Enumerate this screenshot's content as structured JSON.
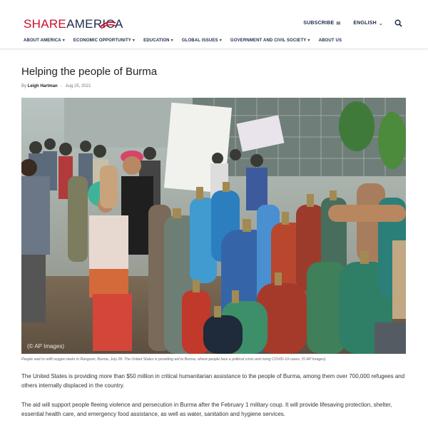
{
  "header": {
    "logo_share": "SHARE",
    "logo_america": "AMERICA",
    "subscribe": "SUBSCRIBE",
    "language": "ENGLISH",
    "search_icon": "search-icon"
  },
  "nav": {
    "items": [
      {
        "label": "ABOUT AMERICA"
      },
      {
        "label": "ECONOMIC OPPORTUNITY"
      },
      {
        "label": "EDUCATION"
      },
      {
        "label": "GLOBAL ISSUES"
      },
      {
        "label": "GOVERNMENT AND CIVIL SOCIETY"
      },
      {
        "label": "ABOUT US"
      }
    ]
  },
  "article": {
    "title": "Helping the people of Burma",
    "by": "By",
    "author": "Leigh Hartman",
    "date": "Aug 25, 2021",
    "photo_watermark": "(© AP Images)",
    "caption": "People wait to refill oxygen tanks in Rangoon, Burma, July 28. The United States is providing aid to Burma, where people face a political crisis and rising COVID-19 cases. (© AP Images)",
    "paragraph_1": "The United States is providing more than $50 million in critical humanitarian assistance to the people of Burma, among them over 700,000 refugees and others internally displaced in the country.",
    "paragraph_2": "The aid will support people fleeing violence and persecution in Burma after the February 1 military coup. It will provide lifesaving protection, shelter, essential health care, and emergency food assistance, as well as water, sanitation and hygiene services."
  },
  "colors": {
    "brand_red": "#c8102e",
    "brand_navy": "#1c2b4a"
  }
}
